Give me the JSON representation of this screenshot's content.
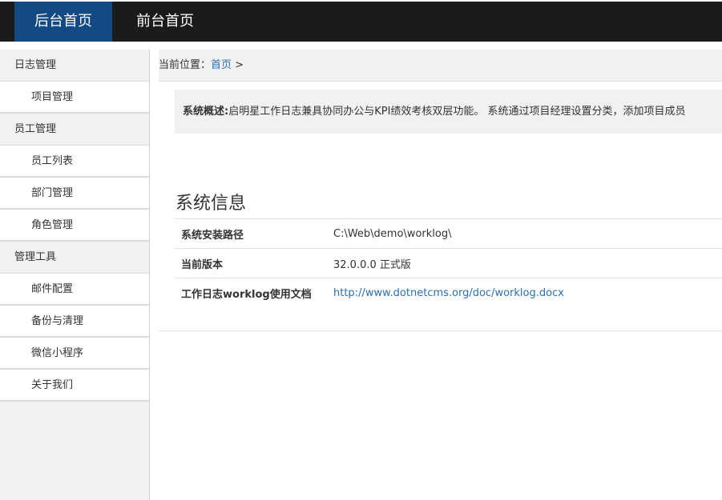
{
  "topnav": {
    "admin_home": "后台首页",
    "front_home": "前台首页"
  },
  "sidebar": {
    "groups": [
      {
        "label": "日志管理",
        "items": [
          "项目管理"
        ]
      },
      {
        "label": "员工管理",
        "items": [
          "员工列表",
          "部门管理",
          "角色管理"
        ]
      },
      {
        "label": "管理工具",
        "items": [
          "邮件配置",
          "备份与清理",
          "微信小程序",
          "关于我们"
        ]
      }
    ]
  },
  "breadcrumb": {
    "prefix": "当前位置：",
    "home": "首页",
    "sep": " >"
  },
  "overview": {
    "label": "系统概述:",
    "text": "启明星工作日志兼具协同办公与KPI绩效考核双层功能。 系统通过项目经理设置分类，添加项目成员"
  },
  "system_info": {
    "title": "系统信息",
    "rows": [
      {
        "key": "系统安装路径",
        "value": "C:\\Web\\demo\\worklog\\"
      },
      {
        "key": "当前版本",
        "value": "32.0.0.0 正式版"
      },
      {
        "key": "工作日志worklog使用文档",
        "value": "http://www.dotnetcms.org/doc/worklog.docx"
      }
    ]
  },
  "colors": {
    "topbar": "#1b1b1b",
    "active_nav": "#134a84",
    "link": "#2a6fb0"
  }
}
